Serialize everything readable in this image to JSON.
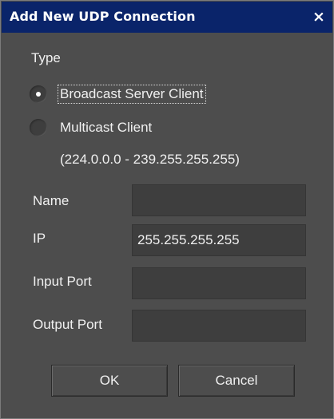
{
  "dialog": {
    "title": "Add New UDP Connection",
    "close_glyph": "×"
  },
  "type_group": {
    "label": "Type",
    "options": [
      {
        "label": "Broadcast Server Client",
        "checked": true
      },
      {
        "label": "Multicast Client",
        "checked": false
      }
    ],
    "multicast_range": "(224.0.0.0 - 239.255.255.255)"
  },
  "fields": {
    "name": {
      "label": "Name",
      "value": ""
    },
    "ip": {
      "label": "IP",
      "value": "255.255.255.255"
    },
    "input_port": {
      "label": "Input Port",
      "value": ""
    },
    "output_port": {
      "label": "Output Port",
      "value": ""
    }
  },
  "buttons": {
    "ok": "OK",
    "cancel": "Cancel"
  },
  "colors": {
    "title_bar": "#0a246a",
    "dialog_bg": "#4d4d4d",
    "field_bg": "#3e3e3e",
    "text": "#f0f0f0"
  },
  "icons": {
    "close": "close-icon",
    "radio_selected": "radio-selected-icon",
    "radio_unselected": "radio-unselected-icon"
  }
}
